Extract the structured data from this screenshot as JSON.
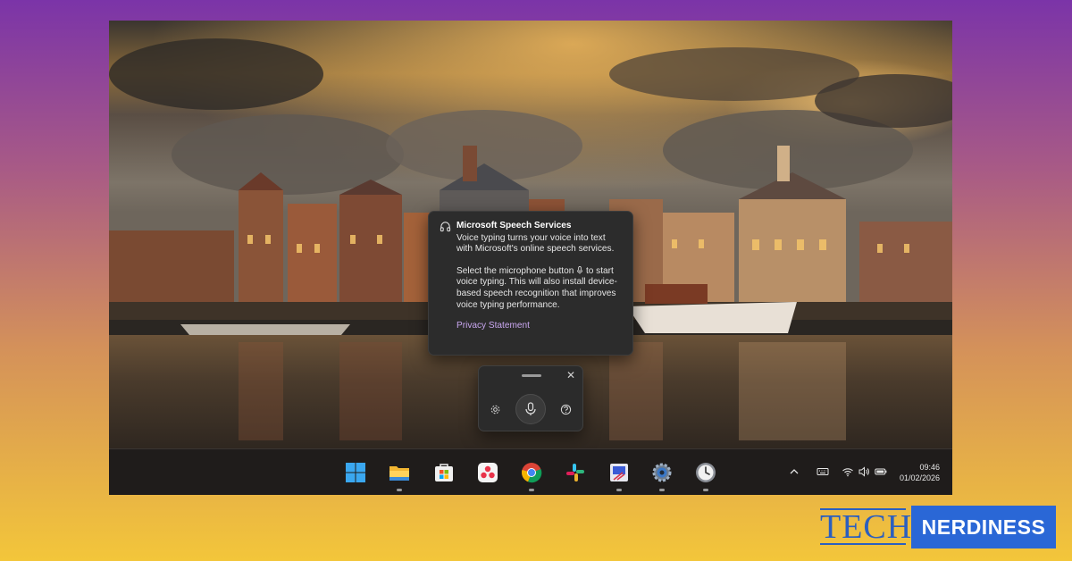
{
  "tooltip": {
    "icon": "headphones-icon",
    "title": "Microsoft Speech Services",
    "paragraph1": "Voice typing turns your voice into text with Microsoft's online speech services.",
    "paragraph2_before": "Select the microphone button",
    "paragraph2_after": "to start voice typing. This will also install device-based speech recognition that improves voice typing performance.",
    "link": "Privacy Statement"
  },
  "voice_bar": {
    "close_glyph": "✕",
    "icons": [
      "gear-icon",
      "microphone-icon",
      "help-icon"
    ]
  },
  "taskbar": {
    "apps": [
      "Start",
      "File Explorer",
      "Microsoft Store",
      "Microsoft 365",
      "Google Chrome",
      "Slack",
      "Snipping Tool",
      "Settings",
      "Clock"
    ],
    "running_indicators": [
      "File Explorer",
      "Google Chrome",
      "Snipping Tool",
      "Settings",
      "Clock"
    ],
    "tray_icons": [
      "chevron-up-icon",
      "keyboard-icon",
      "wifi-icon",
      "volume-icon",
      "battery-icon"
    ],
    "time": "09:46",
    "date": "01/02/2026"
  },
  "branding": {
    "word1": "TECH",
    "word2": "NERDINESS",
    "color_primary": "#2b5fbf",
    "color_box": "#2a67d6"
  },
  "colors": {
    "background_top": "#7b34a8",
    "background_bottom": "#f3c63a",
    "link": "#c9a7f0"
  }
}
